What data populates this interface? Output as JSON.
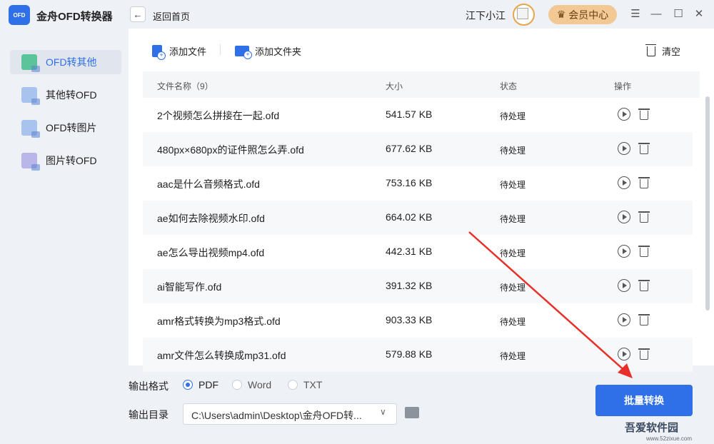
{
  "app": {
    "logo_text": "OFD",
    "title": "金舟OFD转换器"
  },
  "header": {
    "back_icon": "←",
    "back_label": "返回首页",
    "username": "江下小江",
    "vip_label": "会员中心",
    "vip_icon": "♛"
  },
  "window_controls": {
    "menu": "☰",
    "minimize": "—",
    "maximize": "☐",
    "close": "✕"
  },
  "sidebar": {
    "items": [
      {
        "label": "OFD转其他",
        "active": true
      },
      {
        "label": "其他转OFD",
        "active": false
      },
      {
        "label": "OFD转图片",
        "active": false
      },
      {
        "label": "图片转OFD",
        "active": false
      }
    ]
  },
  "toolbar": {
    "add_file": "添加文件",
    "add_folder": "添加文件夹",
    "clear": "清空"
  },
  "table": {
    "headers": {
      "name": "文件名称（9）",
      "size": "大小",
      "status": "状态",
      "ops": "操作"
    },
    "rows": [
      {
        "name": "2个视频怎么拼接在一起.ofd",
        "size": "541.57 KB",
        "status": "待处理"
      },
      {
        "name": "480px×680px的证件照怎么弄.ofd",
        "size": "677.62 KB",
        "status": "待处理"
      },
      {
        "name": "aac是什么音频格式.ofd",
        "size": "753.16 KB",
        "status": "待处理"
      },
      {
        "name": "ae如何去除视频水印.ofd",
        "size": "664.02 KB",
        "status": "待处理"
      },
      {
        "name": "ae怎么导出视频mp4.ofd",
        "size": "442.31 KB",
        "status": "待处理"
      },
      {
        "name": "ai智能写作.ofd",
        "size": "391.32 KB",
        "status": "待处理"
      },
      {
        "name": "amr格式转换为mp3格式.ofd",
        "size": "903.33 KB",
        "status": "待处理"
      },
      {
        "name": "amr文件怎么转换成mp31.ofd",
        "size": "579.88 KB",
        "status": "待处理"
      }
    ]
  },
  "output": {
    "format_label": "输出格式",
    "formats": [
      "PDF",
      "Word",
      "TXT"
    ],
    "selected_format": "PDF",
    "dir_label": "输出目录",
    "dir_value": "C:\\Users\\admin\\Desktop\\金舟OFD转...",
    "dir_chevron": "∨"
  },
  "convert_button": "批量转换",
  "watermark": {
    "main": "吾爱软件园",
    "sub": "www.52zixue.com"
  },
  "colors": {
    "accent": "#2f6fe8",
    "arrow": "#e8302a",
    "vip": "#f2c995"
  }
}
